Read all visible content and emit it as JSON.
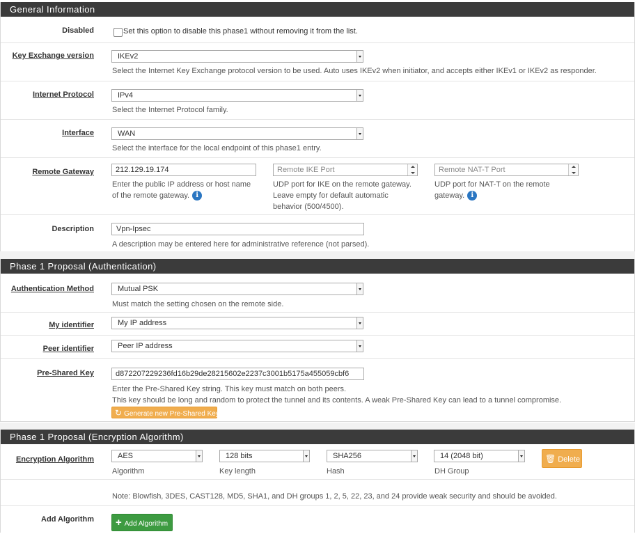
{
  "general": {
    "heading": "General Information",
    "disabled": {
      "label": "Disabled",
      "text": "Set this option to disable this phase1 without removing it from the list."
    },
    "key_exchange": {
      "label": "Key Exchange version",
      "value": "IKEv2",
      "help": "Select the Internet Key Exchange protocol version to be used. Auto uses IKEv2 when initiator, and accepts either IKEv1 or IKEv2 as responder."
    },
    "internet_protocol": {
      "label": "Internet Protocol",
      "value": "IPv4",
      "help": "Select the Internet Protocol family."
    },
    "interface": {
      "label": "Interface",
      "value": "WAN",
      "help": "Select the interface for the local endpoint of this phase1 entry."
    },
    "remote_gateway": {
      "label": "Remote Gateway",
      "value": "212.129.19.174",
      "help_line1": "Enter the public IP address or host name",
      "help_line2": "of the remote gateway.",
      "ike_port_placeholder": "Remote IKE Port",
      "ike_help_line1": "UDP port for IKE on the remote gateway.",
      "ike_help_line2": "Leave empty for default automatic",
      "ike_help_line3": "behavior (500/4500).",
      "natt_placeholder": "Remote NAT-T Port",
      "natt_help_line1": "UDP port for NAT-T on the remote",
      "natt_help_line2": "gateway."
    },
    "description": {
      "label": "Description",
      "value": "Vpn-Ipsec",
      "help": "A description may be entered here for administrative reference (not parsed)."
    }
  },
  "auth": {
    "heading": "Phase 1 Proposal (Authentication)",
    "method": {
      "label": "Authentication Method",
      "value": "Mutual PSK",
      "help": "Must match the setting chosen on the remote side."
    },
    "my_id": {
      "label": "My identifier",
      "value": "My IP address"
    },
    "peer_id": {
      "label": "Peer identifier",
      "value": "Peer IP address"
    },
    "psk": {
      "label": "Pre-Shared Key",
      "value": "d872207229236fd16b29de28215602e2237c3001b5175a455059cbf6",
      "help_line1": "Enter the Pre-Shared Key string. This key must match on both peers.",
      "help_line2": "This key should be long and random to protect the tunnel and its contents. A weak Pre-Shared Key can lead to a tunnel compromise.",
      "generate_button": "Generate new Pre-Shared Key"
    }
  },
  "encryption": {
    "heading": "Phase 1 Proposal (Encryption Algorithm)",
    "algorithm": {
      "label": "Encryption Algorithm",
      "algo_value": "AES",
      "algo_caption": "Algorithm",
      "keylen_value": "128 bits",
      "keylen_caption": "Key length",
      "hash_value": "SHA256",
      "hash_caption": "Hash",
      "dh_value": "14 (2048 bit)",
      "dh_caption": "DH Group",
      "delete_button": "Delete"
    },
    "note": "Note: Blowfish, 3DES, CAST128, MD5, SHA1, and DH groups 1, 2, 5, 22, 23, and 24 provide weak security and should be avoided.",
    "add": {
      "label": "Add Algorithm",
      "button": "Add Algorithm"
    }
  },
  "colors": {
    "heading_bg": "#3b3b3b",
    "info": "#2a76c2",
    "warning": "#f0ad4e",
    "success": "#3d9b41"
  }
}
